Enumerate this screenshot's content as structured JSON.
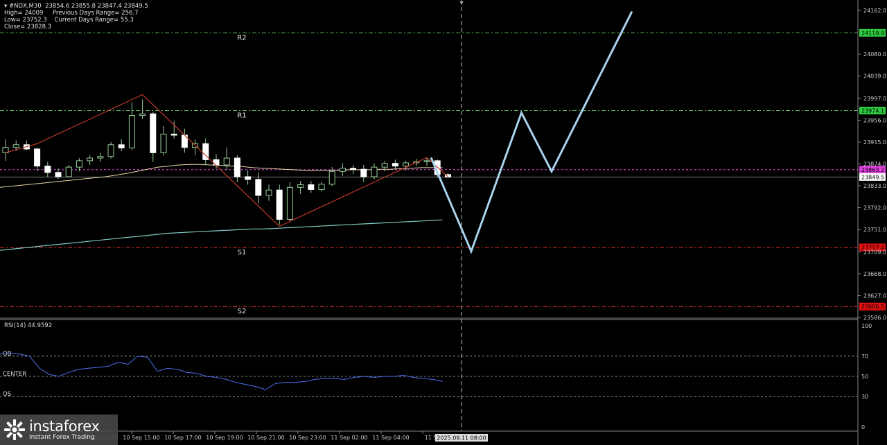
{
  "header": {
    "symbol": "#NDX,M30",
    "ohlc": "23854.6 23855.8 23847.4 23849.5",
    "high": "High= 24009",
    "low": "Low= 23752.3",
    "close": "Close= 23828.3",
    "prev_range": "Previous Days Range= 256.7",
    "curr_range": "Current Days Range= 55.3"
  },
  "logo": {
    "brand": "instaforex",
    "tagline": "Instant Forex Trading"
  },
  "colors": {
    "background": "#000000",
    "bull": "#ffffff",
    "bear": "#ffffff",
    "wick": "#9ad09a",
    "resistance": "#5fbf5f",
    "support": "#e03030",
    "pivot": "#e040e0",
    "forecast": "#a9d2ec",
    "ma_slow": "#7fc7c2",
    "ma_fast": "#e8d7a2",
    "zigzag": "#c0392b",
    "rsi": "#4a6ff0"
  },
  "chart_data": {
    "type": "candlestick",
    "ylim": [
      23586.0,
      24175.0
    ],
    "y_ticks": [
      "24162.0",
      "24080.0",
      "24039.0",
      "23997.0",
      "23956.0",
      "23915.0",
      "23874.0",
      "23833.0",
      "23792.0",
      "23751.0",
      "23709.0",
      "23668.0",
      "23627.0",
      "23586.0"
    ],
    "x_labels": [
      "10 Sep 13:00",
      "10 Sep 15:00",
      "10 Sep 17:00",
      "10 Sep 19:00",
      "10 Sep 21:00",
      "10 Sep 23:00",
      "11 Sep 02:00",
      "11 Sep 04:00",
      "11 Se"
    ],
    "cursor_time": "2025.09.11 08:00",
    "levels": [
      {
        "name": "R2",
        "price": 24119.9,
        "label": "24119.9",
        "kind": "resistance"
      },
      {
        "name": "R1",
        "price": 23974.1,
        "label": "23974.1",
        "kind": "resistance"
      },
      {
        "name": "",
        "price": 23863.2,
        "label": "23863.2",
        "kind": "pivot"
      },
      {
        "name": "",
        "price": 23849.5,
        "label": "23849.5",
        "kind": "current"
      },
      {
        "name": "S1",
        "price": 23717.4,
        "label": "23717.4",
        "kind": "support"
      },
      {
        "name": "S2",
        "price": 23606.5,
        "label": "23606.5",
        "kind": "support"
      }
    ],
    "candles": [
      {
        "o": 23895,
        "h": 23920,
        "l": 23880,
        "c": 23905
      },
      {
        "o": 23905,
        "h": 23918,
        "l": 23898,
        "c": 23910
      },
      {
        "o": 23910,
        "h": 23918,
        "l": 23900,
        "c": 23902
      },
      {
        "o": 23902,
        "h": 23905,
        "l": 23860,
        "c": 23870
      },
      {
        "o": 23870,
        "h": 23878,
        "l": 23850,
        "c": 23858
      },
      {
        "o": 23858,
        "h": 23866,
        "l": 23846,
        "c": 23850
      },
      {
        "o": 23850,
        "h": 23872,
        "l": 23848,
        "c": 23868
      },
      {
        "o": 23868,
        "h": 23885,
        "l": 23860,
        "c": 23880
      },
      {
        "o": 23880,
        "h": 23890,
        "l": 23872,
        "c": 23885
      },
      {
        "o": 23885,
        "h": 23895,
        "l": 23878,
        "c": 23888
      },
      {
        "o": 23888,
        "h": 23915,
        "l": 23884,
        "c": 23910
      },
      {
        "o": 23910,
        "h": 23920,
        "l": 23898,
        "c": 23904
      },
      {
        "o": 23904,
        "h": 23990,
        "l": 23900,
        "c": 23965
      },
      {
        "o": 23965,
        "h": 23995,
        "l": 23958,
        "c": 23968
      },
      {
        "o": 23968,
        "h": 23972,
        "l": 23878,
        "c": 23895
      },
      {
        "o": 23895,
        "h": 23945,
        "l": 23890,
        "c": 23930
      },
      {
        "o": 23930,
        "h": 23955,
        "l": 23922,
        "c": 23928
      },
      {
        "o": 23928,
        "h": 23940,
        "l": 23895,
        "c": 23905
      },
      {
        "o": 23905,
        "h": 23920,
        "l": 23890,
        "c": 23912
      },
      {
        "o": 23912,
        "h": 23922,
        "l": 23872,
        "c": 23882
      },
      {
        "o": 23882,
        "h": 23892,
        "l": 23865,
        "c": 23872
      },
      {
        "o": 23872,
        "h": 23905,
        "l": 23862,
        "c": 23885
      },
      {
        "o": 23885,
        "h": 23890,
        "l": 23840,
        "c": 23850
      },
      {
        "o": 23850,
        "h": 23862,
        "l": 23835,
        "c": 23845
      },
      {
        "o": 23845,
        "h": 23858,
        "l": 23800,
        "c": 23815
      },
      {
        "o": 23815,
        "h": 23835,
        "l": 23805,
        "c": 23825
      },
      {
        "o": 23825,
        "h": 23835,
        "l": 23760,
        "c": 23770
      },
      {
        "o": 23770,
        "h": 23840,
        "l": 23765,
        "c": 23830
      },
      {
        "o": 23830,
        "h": 23842,
        "l": 23818,
        "c": 23835
      },
      {
        "o": 23835,
        "h": 23842,
        "l": 23820,
        "c": 23826
      },
      {
        "o": 23826,
        "h": 23840,
        "l": 23822,
        "c": 23836
      },
      {
        "o": 23836,
        "h": 23868,
        "l": 23832,
        "c": 23860
      },
      {
        "o": 23860,
        "h": 23875,
        "l": 23852,
        "c": 23866
      },
      {
        "o": 23866,
        "h": 23872,
        "l": 23855,
        "c": 23864
      },
      {
        "o": 23864,
        "h": 23872,
        "l": 23840,
        "c": 23850
      },
      {
        "o": 23850,
        "h": 23875,
        "l": 23845,
        "c": 23868
      },
      {
        "o": 23868,
        "h": 23880,
        "l": 23860,
        "c": 23875
      },
      {
        "o": 23875,
        "h": 23882,
        "l": 23865,
        "c": 23870
      },
      {
        "o": 23870,
        "h": 23880,
        "l": 23862,
        "c": 23876
      },
      {
        "o": 23876,
        "h": 23884,
        "l": 23870,
        "c": 23878
      },
      {
        "o": 23878,
        "h": 23886,
        "l": 23870,
        "c": 23880
      },
      {
        "o": 23880,
        "h": 23882,
        "l": 23848,
        "c": 23854
      },
      {
        "o": 23854,
        "h": 23856,
        "l": 23847,
        "c": 23849.5
      }
    ],
    "ma_fast": [
      23830,
      23832,
      23834,
      23836,
      23838,
      23840,
      23842,
      23844,
      23846,
      23848,
      23850,
      23853,
      23856,
      23860,
      23864,
      23868,
      23870,
      23872,
      23873,
      23873,
      23872,
      23871,
      23870,
      23869,
      23867,
      23866,
      23865,
      23864,
      23863,
      23862,
      23862,
      23862,
      23862,
      23863,
      23863,
      23863,
      23864,
      23864,
      23865,
      23866,
      23867,
      23867,
      23867
    ],
    "ma_slow": [
      23712,
      23714,
      23716,
      23718,
      23720,
      23722,
      23724,
      23726,
      23728,
      23730,
      23732,
      23734,
      23736,
      23738,
      23740,
      23742,
      23744,
      23745,
      23746,
      23747,
      23748,
      23749,
      23750,
      23751,
      23752,
      23752,
      23753,
      23754,
      23755,
      23756,
      23757,
      23758,
      23759,
      23760,
      23761,
      23762,
      23763,
      23764,
      23765,
      23766,
      23767,
      23768,
      23769
    ],
    "zigzag": [
      [
        0,
        23895
      ],
      [
        3,
        23912
      ],
      [
        13,
        24004
      ],
      [
        26,
        23757
      ],
      [
        40,
        23886
      ],
      [
        42,
        23850
      ]
    ],
    "forecast": [
      [
        0,
        23886
      ],
      [
        4,
        23710
      ],
      [
        9,
        23970
      ],
      [
        12,
        23860
      ],
      [
        20,
        24160
      ]
    ],
    "rsi": {
      "label": "RSI(14) 44.9592",
      "ylim": [
        0,
        100
      ],
      "ticks": [
        "100",
        "70",
        "50",
        "30",
        "0"
      ],
      "levels": [
        {
          "value": 70,
          "name": "OB"
        },
        {
          "value": 50,
          "name": "CENTER"
        },
        {
          "value": 30,
          "name": "OS"
        }
      ],
      "values": [
        72,
        73,
        72,
        70,
        58,
        52,
        50,
        54,
        57,
        58,
        59,
        60,
        64,
        62,
        70,
        69,
        55,
        58,
        57,
        54,
        53,
        50,
        49,
        47,
        44,
        42,
        40,
        37,
        43,
        44,
        44,
        45,
        47,
        48,
        48,
        47,
        49,
        50,
        49,
        50,
        50,
        51,
        49,
        48,
        47,
        45
      ]
    }
  }
}
